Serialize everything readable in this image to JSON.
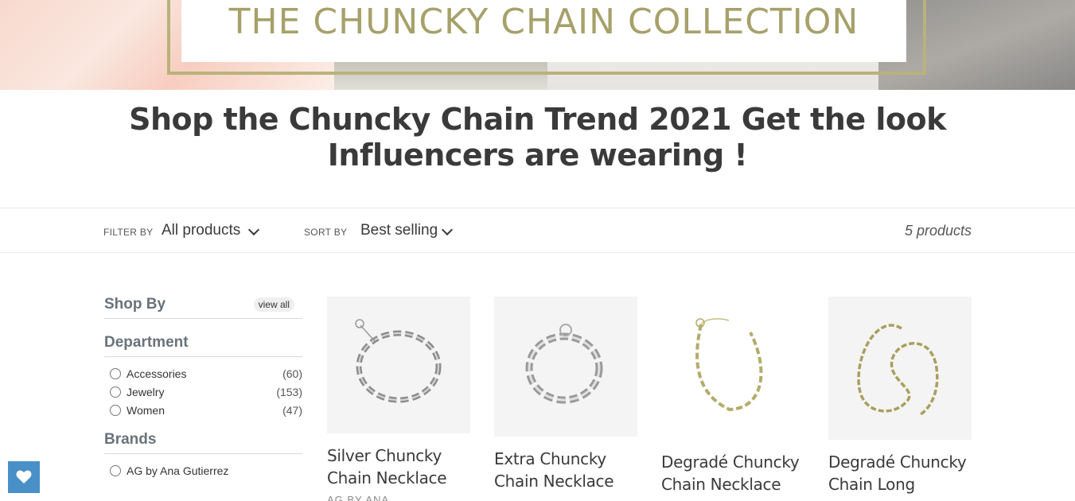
{
  "hero": {
    "title": "THE CHUNCKY CHAIN COLLECTION"
  },
  "page": {
    "title": "Shop the Chuncky Chain Trend 2021 Get the look Influencers are wearing !"
  },
  "filter_bar": {
    "filter_label": "FILTER BY",
    "filter_value": "All products",
    "sort_label": "SORT BY",
    "sort_value": "Best selling",
    "count": "5 products"
  },
  "sidebar": {
    "shop_by": "Shop By",
    "view_all": "view all",
    "department": {
      "title": "Department",
      "items": [
        {
          "label": "Accessories",
          "count": "(60)"
        },
        {
          "label": "Jewelry",
          "count": "(153)"
        },
        {
          "label": "Women",
          "count": "(47)"
        }
      ]
    },
    "brands": {
      "title": "Brands",
      "items": [
        {
          "label": "AG by Ana Gutierrez"
        }
      ]
    }
  },
  "products": [
    {
      "name": "Silver Chuncky Chain Necklace",
      "vendor": "AG BY ANA",
      "color": "silver"
    },
    {
      "name": "Extra Chuncky Chain Necklace",
      "vendor": "",
      "color": "silver"
    },
    {
      "name": "Degradé Chuncky Chain Necklace",
      "vendor": "",
      "color": "gold"
    },
    {
      "name": "Degradé Chuncky Chain Long",
      "vendor": "",
      "color": "gold"
    }
  ],
  "colors": {
    "accent_gold": "#b9b27a",
    "wishlist_blue": "#4a90c8"
  }
}
